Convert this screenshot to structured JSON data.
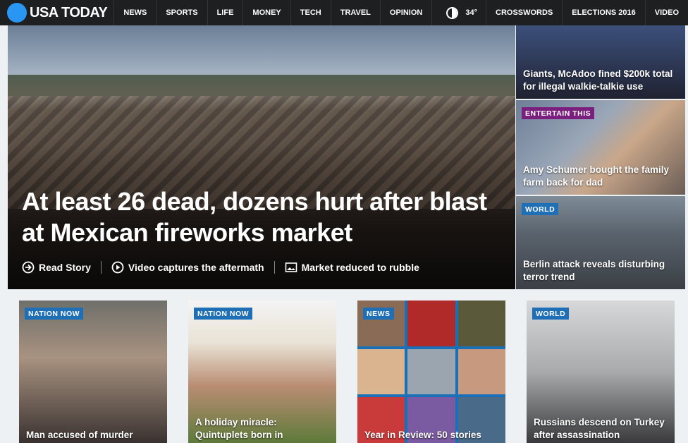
{
  "brand": {
    "name": "USA TODAY",
    "accent": "#2a96f4"
  },
  "nav": {
    "items": [
      "NEWS",
      "SPORTS",
      "LIFE",
      "MONEY",
      "TECH",
      "TRAVEL",
      "OPINION"
    ],
    "weather_temp": "34°",
    "extra_items": [
      "CROSSWORDS",
      "ELECTIONS 2016",
      "VIDEO"
    ]
  },
  "hero": {
    "headline": "At least 26 dead, dozens hurt after blast at Mexican fireworks market",
    "links": [
      {
        "icon": "arrow-circle-icon",
        "label": "Read Story"
      },
      {
        "icon": "play-circle-icon",
        "label": "Video captures the aftermath"
      },
      {
        "icon": "photo-icon",
        "label": "Market reduced to rubble"
      }
    ]
  },
  "side": [
    {
      "badge": "",
      "text": "Giants, McAdoo fined $200k total for illegal walkie-talkie use"
    },
    {
      "badge": "ENTERTAIN THIS",
      "badge_color": "#7b1f7f",
      "text": "Amy Schumer bought the family farm back for dad"
    },
    {
      "badge": "WORLD",
      "badge_color": "#1f6fb6",
      "text": "Berlin attack reveals disturbing terror trend"
    }
  ],
  "cards": [
    {
      "badge": "NATION NOW",
      "text": "Man accused of murder"
    },
    {
      "badge": "NATION NOW",
      "text": "A holiday miracle: Quintuplets born in"
    },
    {
      "badge": "NEWS",
      "text": "Year in Review: 50 stories"
    },
    {
      "badge": "WORLD",
      "text": "Russians descend on Turkey after assassination"
    }
  ]
}
